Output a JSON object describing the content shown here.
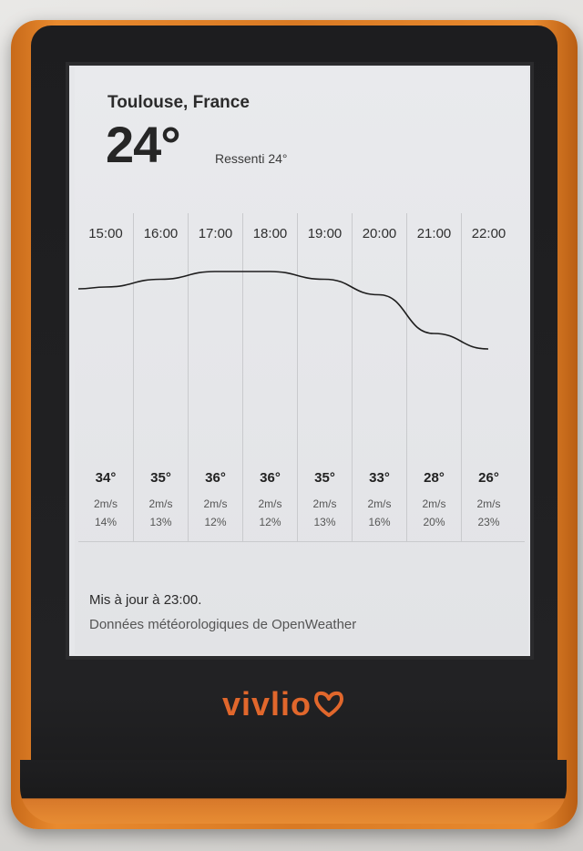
{
  "weather": {
    "location": "Toulouse, France",
    "current_temp": "24°",
    "feels_like": "Ressenti 24°"
  },
  "forecast": [
    {
      "hour": "15:00",
      "temp": "34°",
      "wind": "2m/s",
      "rain": "14%",
      "curve": 34
    },
    {
      "hour": "16:00",
      "temp": "35°",
      "wind": "2m/s",
      "rain": "13%",
      "curve": 35
    },
    {
      "hour": "17:00",
      "temp": "36°",
      "wind": "2m/s",
      "rain": "12%",
      "curve": 36
    },
    {
      "hour": "18:00",
      "temp": "36°",
      "wind": "2m/s",
      "rain": "12%",
      "curve": 36
    },
    {
      "hour": "19:00",
      "temp": "35°",
      "wind": "2m/s",
      "rain": "13%",
      "curve": 35
    },
    {
      "hour": "20:00",
      "temp": "33°",
      "wind": "2m/s",
      "rain": "16%",
      "curve": 33
    },
    {
      "hour": "21:00",
      "temp": "28°",
      "wind": "2m/s",
      "rain": "20%",
      "curve": 28
    },
    {
      "hour": "22:00",
      "temp": "26°",
      "wind": "2m/s",
      "rain": "23%",
      "curve": 26
    }
  ],
  "footer": {
    "updated": "Mis à jour à 23:00.",
    "source": "Données météorologiques de OpenWeather"
  },
  "device": {
    "brand": "vivlio",
    "brand_color": "#e1672c",
    "brand_icon": "heart-check-icon"
  }
}
